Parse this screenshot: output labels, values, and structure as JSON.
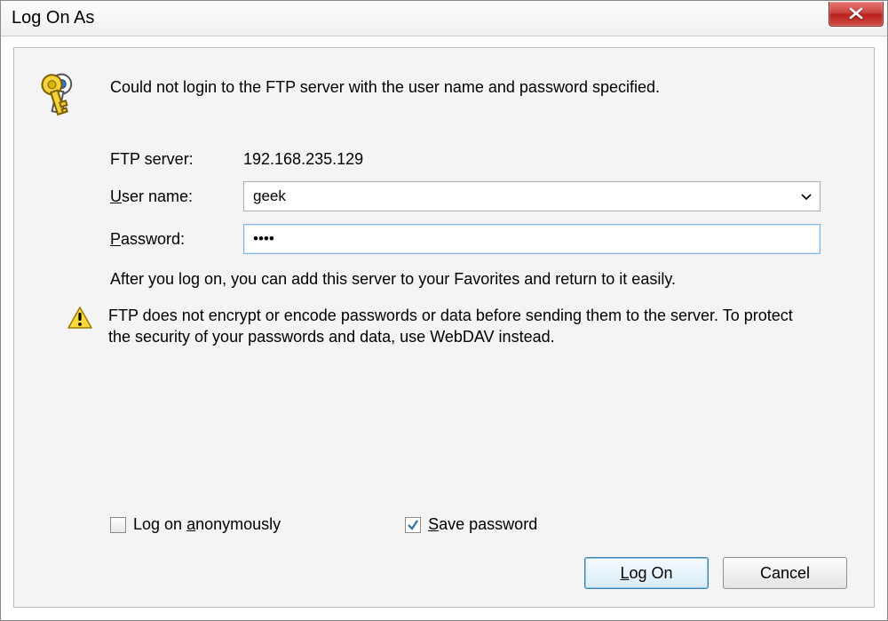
{
  "title": "Log On As",
  "error_message": "Could not login to the FTP server with the user name and password specified.",
  "labels": {
    "ftp_server": "FTP server:",
    "user_name_prefix": "U",
    "user_name_rest": "ser name:",
    "password_prefix": "P",
    "password_rest": "assword:"
  },
  "values": {
    "ftp_server": "192.168.235.129",
    "user_name": "geek",
    "password_display": "••••"
  },
  "hint": "After you log on, you can add this server to your Favorites and return to it easily.",
  "warning": "FTP does not encrypt or encode passwords or data before sending them to the server.  To protect the security of your passwords and data, use WebDAV instead.",
  "checkboxes": {
    "anon_pre": "Log on ",
    "anon_ak": "a",
    "anon_post": "nonymously",
    "anon_checked": false,
    "save_ak": "S",
    "save_post": "ave password",
    "save_checked": true
  },
  "buttons": {
    "logon_ak": "L",
    "logon_post": "og On",
    "cancel": "Cancel"
  }
}
